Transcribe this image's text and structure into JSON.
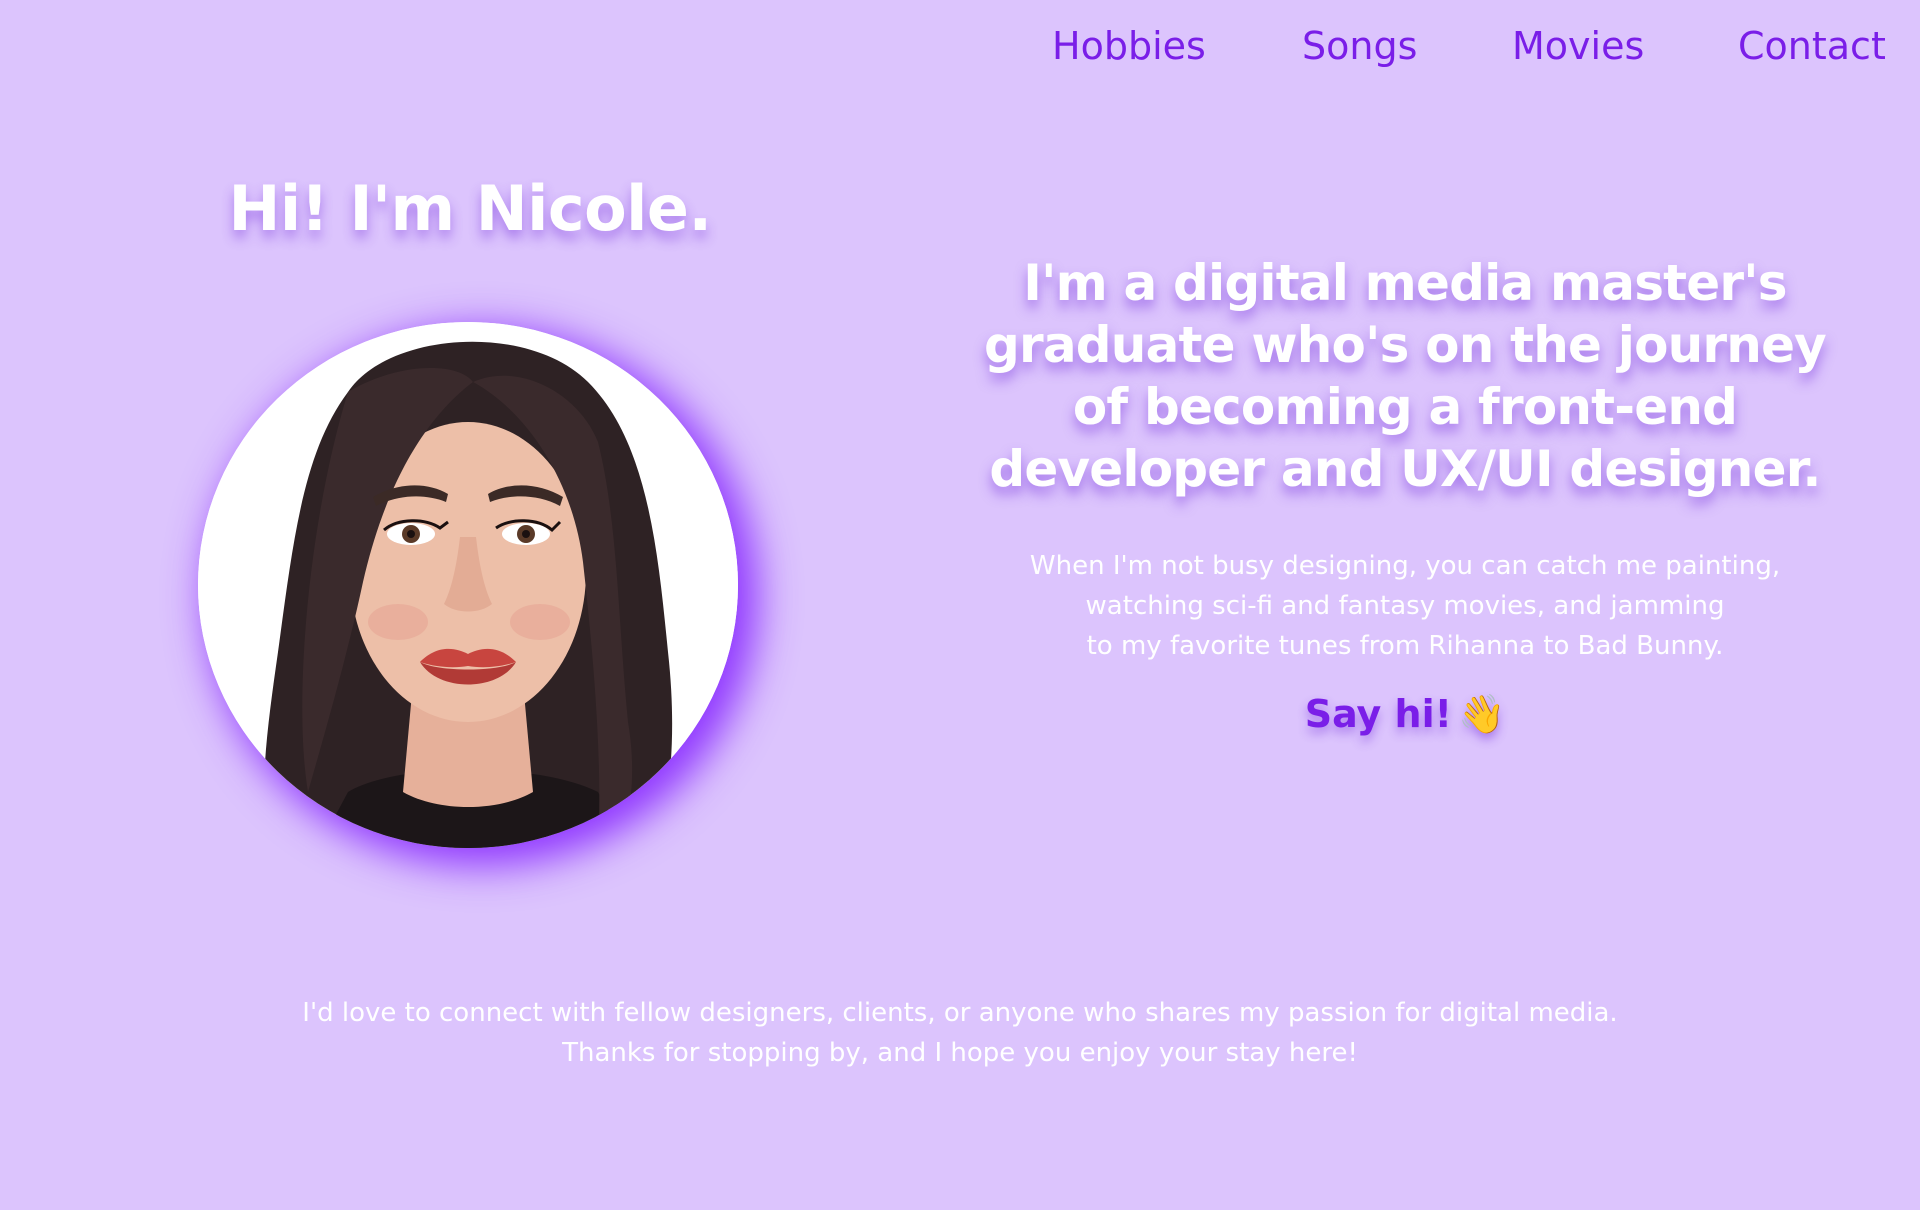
{
  "nav": {
    "items": [
      {
        "label": "Hobbies"
      },
      {
        "label": "Songs"
      },
      {
        "label": "Movies"
      },
      {
        "label": "Contact"
      }
    ]
  },
  "hero": {
    "title": "Hi! I'm Nicole."
  },
  "intro": {
    "tagline": "I'm a digital media master's graduate who's on the journey of becoming a front-end developer and UX/UI designer.",
    "about_lines": [
      "When I'm not busy designing, you can catch me painting,",
      "watching sci-fi and fantasy movies, and jamming",
      "to my favorite tunes from Rihanna to Bad Bunny."
    ],
    "say_hi": "Say hi!",
    "say_hi_emoji": "👋"
  },
  "closing": {
    "lines": [
      "I'd love to connect with fellow designers, clients, or anyone who shares my passion for digital media.",
      "Thanks for stopping by, and I hope you enjoy your stay here!"
    ]
  },
  "colors": {
    "background": "#dcc4fd",
    "accent": "#7a1ee8",
    "text": "#ffffff",
    "glow": "#8a2bff"
  },
  "avatar": {
    "icon": "profile-portrait"
  }
}
